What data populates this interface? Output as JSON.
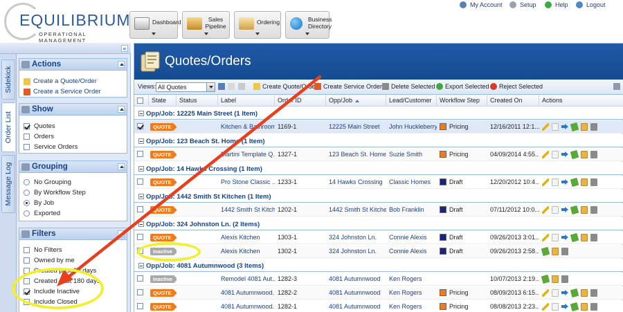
{
  "brand": {
    "name": "EQUILIBRIUM",
    "tagline": "OPERATIONAL MANAGEMENT"
  },
  "nav": [
    {
      "label": "Dashboard",
      "icon": "dashboard-icon"
    },
    {
      "label": "Sales Pipeline",
      "icon": "pipeline-icon"
    },
    {
      "label": "Ordering",
      "icon": "ordering-icon"
    },
    {
      "label": "Business Directory",
      "icon": "globe-icon"
    }
  ],
  "toplinks": {
    "account": "My Account",
    "setup": "Setup",
    "help": "Help",
    "logout": "Logout"
  },
  "sidebar": {
    "tabs": {
      "sidekick": "Sidekick",
      "order_list": "Order List",
      "message_log": "Message Log"
    },
    "actions": {
      "title": "Actions",
      "create_quote": "Create a Quote/Order",
      "create_service": "Create a Service Order"
    },
    "show": {
      "title": "Show",
      "items": [
        {
          "label": "Quotes",
          "checked": true
        },
        {
          "label": "Orders",
          "checked": false
        },
        {
          "label": "Service Orders",
          "checked": false
        }
      ]
    },
    "grouping": {
      "title": "Grouping",
      "items": [
        {
          "label": "No Grouping",
          "selected": false
        },
        {
          "label": "By Workflow Step",
          "selected": false
        },
        {
          "label": "By Job",
          "selected": true
        },
        {
          "label": "Exported",
          "selected": false
        }
      ]
    },
    "filters": {
      "title": "Filters",
      "items": [
        {
          "label": "No Filters",
          "checked": false
        },
        {
          "label": "Owned by me",
          "checked": false
        },
        {
          "label": "Created past 30 days",
          "checked": false
        },
        {
          "label": "Created past 180 days",
          "checked": false
        },
        {
          "label": "Include Inactive",
          "checked": true
        },
        {
          "label": "Include Closed",
          "checked": false
        }
      ]
    }
  },
  "page": {
    "title": "Quotes/Orders"
  },
  "toolbar": {
    "views_label": "Views:",
    "views_value": "All Quotes",
    "create_quote": "Create Quote/Order",
    "create_service": "Create Service Order",
    "delete_selected": "Delete Selected",
    "export_selected": "Export Selected",
    "reject_selected": "Reject Selected"
  },
  "columns": {
    "state": "State",
    "status": "Status",
    "label": "Label",
    "order_id": "Order ID",
    "opp_job": "Opp/Job",
    "lead": "Lead/Customer",
    "workflow": "Workflow Step",
    "created": "Created On",
    "actions": "Actions"
  },
  "groups": [
    {
      "title": "Opp/Job: 12225 Main Street (1 Item)",
      "rows": [
        {
          "checked": true,
          "status": "QUOTE",
          "label": "Kitchen & Bathroom",
          "order_id": "1169-1",
          "opp_job": "12225 Main Street",
          "lead": "John Huckleberry",
          "workflow": "Pricing",
          "workflow_color": "#f07a1e",
          "created": "12/16/2011 12:1...",
          "inactive": false
        }
      ]
    },
    {
      "title": "Opp/Job: 123 Beach St. Home (1 Item)",
      "rows": [
        {
          "checked": false,
          "status": "QUOTE",
          "label": "Martini Template Q...",
          "order_id": "1327-1",
          "opp_job": "123 Beach St. Home",
          "lead": "Suzie Smith",
          "workflow": "Pricing",
          "workflow_color": "#f07a1e",
          "created": "04/09/2014 4:55...",
          "inactive": false
        }
      ]
    },
    {
      "title": "Opp/Job: 14 Hawks Crossing (1 Item)",
      "rows": [
        {
          "checked": false,
          "status": "QUOTE",
          "label": "Pro Stone Classic ...",
          "order_id": "1233-1",
          "opp_job": "14 Hawks Crossing",
          "lead": "Classic Homes",
          "workflow": "Draft",
          "workflow_color": "#1a237e",
          "created": "12/20/2012 10:4...",
          "inactive": false
        }
      ]
    },
    {
      "title": "Opp/Job: 1442 Smith St Kitchen (1 Item)",
      "rows": [
        {
          "checked": false,
          "status": "QUOTE",
          "label": "1442 Smith St Kitchen",
          "order_id": "1202-1",
          "opp_job": "1442 Smith St Kitchen",
          "lead": "Bob Franklin",
          "workflow": "Draft",
          "workflow_color": "#1a237e",
          "created": "07/11/2012 10:0...",
          "inactive": false
        }
      ]
    },
    {
      "title": "Opp/Job: 324 Johnston Ln. (2 Items)",
      "rows": [
        {
          "checked": false,
          "status": "QUOTE",
          "label": "Alexis Kitchen",
          "order_id": "1303-1",
          "opp_job": "324 Johnston Ln.",
          "lead": "Connie Alexis",
          "workflow": "Draft",
          "workflow_color": "#1a237e",
          "created": "09/26/2013 3:01...",
          "inactive": false
        },
        {
          "checked": false,
          "status": "Inactive",
          "label": "Alexis Kitchen",
          "order_id": "1302-1",
          "opp_job": "324 Johnston Ln.",
          "lead": "Connie Alexis",
          "workflow": "Draft",
          "workflow_color": "#1a237e",
          "created": "09/26/2013 2:58...",
          "inactive": true
        }
      ]
    },
    {
      "title": "Opp/Job: 4081 Autumnwood (3 Items)",
      "rows": [
        {
          "checked": false,
          "status": "Inactive",
          "label": "Remodel 4081 Aut...",
          "order_id": "1282-3",
          "opp_job": "4081 Autumnwood",
          "lead": "Ken Rogers",
          "workflow": "",
          "workflow_color": "#1a237e",
          "created": "10/07/2013 2:19...",
          "inactive": true
        },
        {
          "checked": false,
          "status": "QUOTE",
          "label": "4081 Autumnwood...",
          "order_id": "1282-2",
          "opp_job": "4081 Autumnwood",
          "lead": "Ken Rogers",
          "workflow": "Pricing",
          "workflow_color": "#f07a1e",
          "created": "08/09/2013 6:15...",
          "inactive": false
        },
        {
          "checked": false,
          "status": "QUOTE",
          "label": "4081 Autumnwood...",
          "order_id": "1282-1",
          "opp_job": "4081 Autumnwood",
          "lead": "Ken Rogers",
          "workflow": "Pricing",
          "workflow_color": "#f07a1e",
          "created": "08/08/2013 2:23...",
          "inactive": false
        }
      ]
    }
  ],
  "colors": {
    "accent": "#15428b",
    "banner": "#1f5aa6",
    "quote_badge": "#f07a1e",
    "inactive_badge": "#a9a9a9",
    "annotation_arrow": "#e8401c",
    "annotation_halo": "#f2ef2e"
  }
}
